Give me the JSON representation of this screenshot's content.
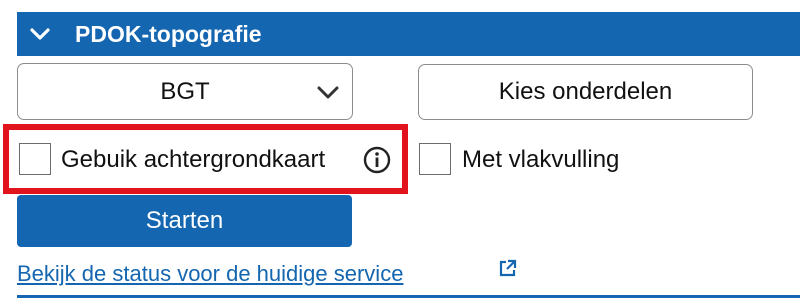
{
  "panel": {
    "title": "PDOK-topografie",
    "expand_icon": "chevron-down-icon"
  },
  "dataset_select": {
    "selected": "BGT",
    "icon": "chevron-down-icon"
  },
  "parts_button": {
    "label": "Kies onderdelen"
  },
  "options": {
    "background_map": {
      "label": "Gebuik achtergrondkaart",
      "checked": false,
      "icon": "info-icon",
      "highlighted": true
    },
    "area_fill": {
      "label": "Met vlakvulling",
      "checked": false
    }
  },
  "start_button": {
    "label": "Starten"
  },
  "status_link": {
    "label": "Bekijk de status voor de huidige service",
    "icon": "external-link-icon"
  },
  "colors": {
    "accent": "#1466b0",
    "highlight": "#e1131c"
  }
}
